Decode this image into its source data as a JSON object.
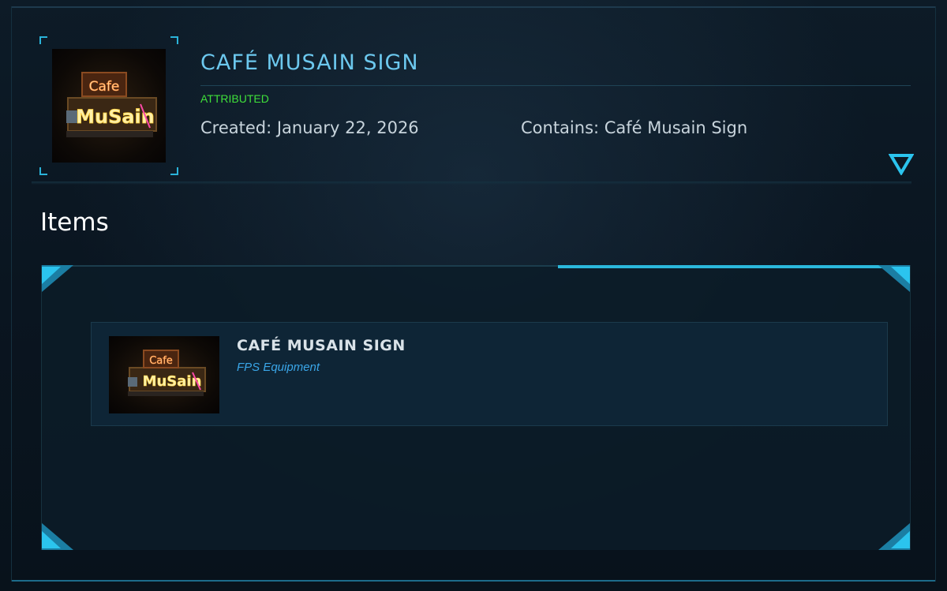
{
  "header": {
    "title": "CAFÉ MUSAIN SIGN",
    "status": "ATTRIBUTED",
    "created": "Created: January 22, 2026",
    "contains": "Contains: Café Musain Sign"
  },
  "items_section": {
    "heading": "Items",
    "items": [
      {
        "name": "CAFÉ MUSAIN SIGN",
        "category": "FPS Equipment"
      }
    ]
  },
  "thumbnail": {
    "sign_text_top": "Cafe",
    "sign_text_main": "MuSain"
  },
  "colors": {
    "accent": "#2bb8dc",
    "title": "#6cc8ee",
    "status": "#3fe03a",
    "category": "#3aa6e8",
    "background": "#0a1520"
  },
  "icons": {
    "expand": "chevron-down-triangle-icon"
  }
}
